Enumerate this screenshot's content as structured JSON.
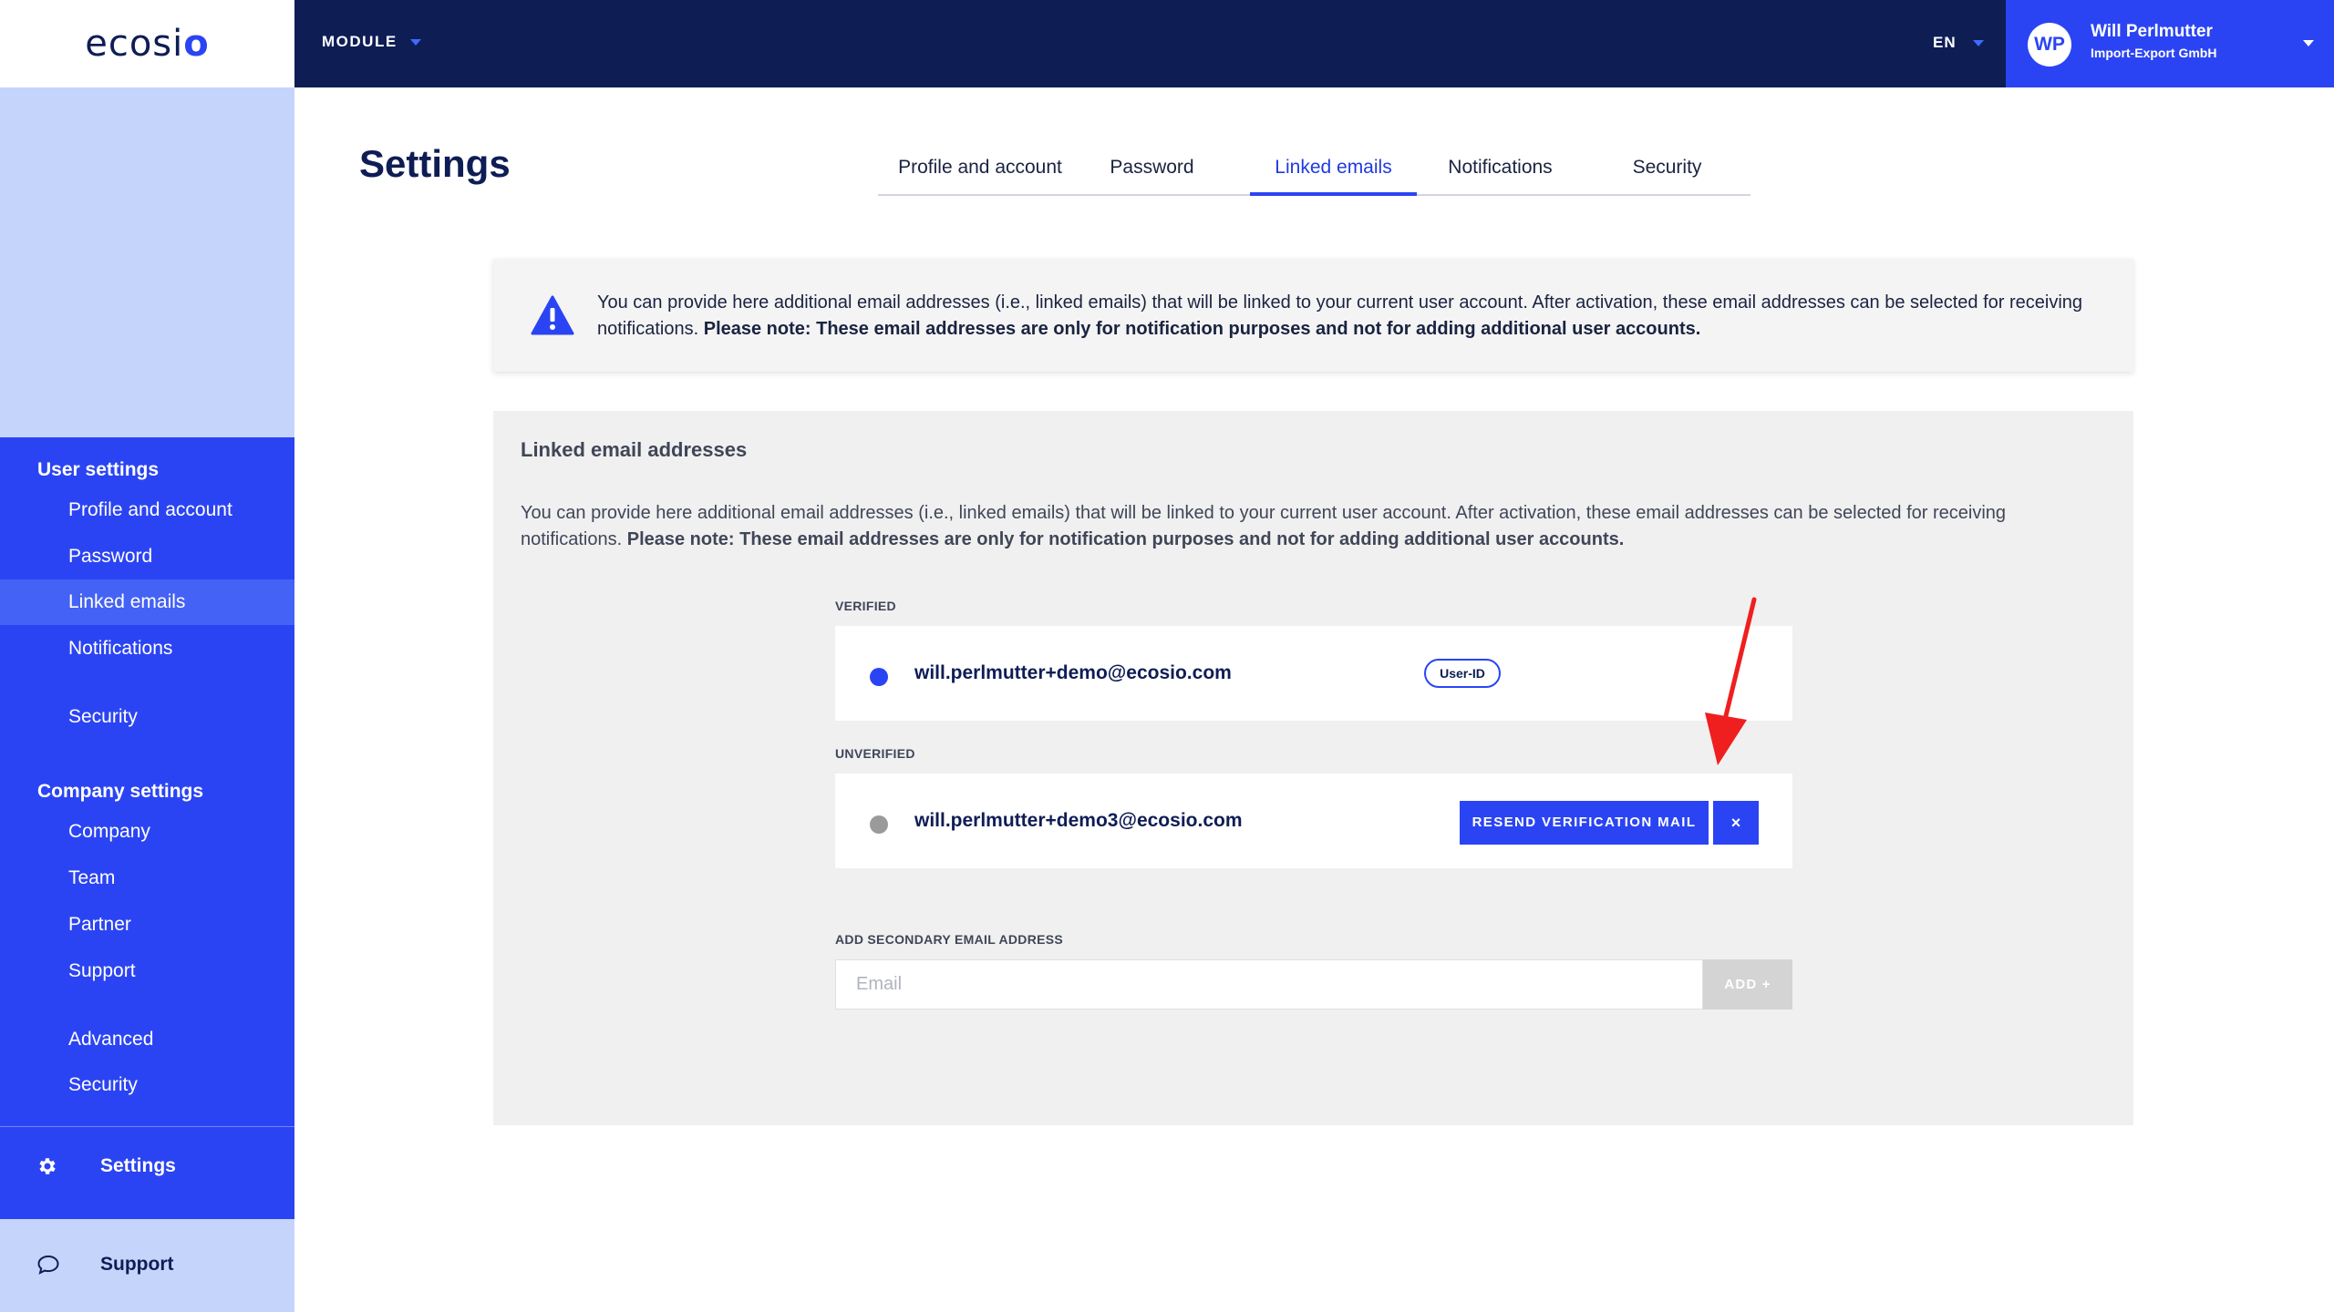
{
  "logo": "ecosio",
  "topbar": {
    "module_label": "MODULE",
    "language": "EN",
    "user": {
      "initials": "WP",
      "name": "Will Perlmutter",
      "company": "Import-Export GmbH"
    }
  },
  "sidebar": {
    "user_settings_title": "User settings",
    "user_items": [
      {
        "label": "Profile and account"
      },
      {
        "label": "Password"
      },
      {
        "label": "Linked emails",
        "active": true
      },
      {
        "label": "Notifications"
      },
      {
        "label": "Security"
      }
    ],
    "company_settings_title": "Company settings",
    "company_items": [
      {
        "label": "Company"
      },
      {
        "label": "Team"
      },
      {
        "label": "Partner"
      },
      {
        "label": "Support"
      },
      {
        "label": "Advanced"
      },
      {
        "label": "Security"
      }
    ],
    "settings_label": "Settings",
    "support_label": "Support"
  },
  "page": {
    "title": "Settings",
    "tabs": [
      {
        "label": "Profile and account"
      },
      {
        "label": "Password"
      },
      {
        "label": "Linked emails",
        "active": true
      },
      {
        "label": "Notifications"
      },
      {
        "label": "Security"
      }
    ]
  },
  "info": {
    "text": "You can provide here additional email addresses (i.e., linked emails) that will be linked to your current user account. After activation, these email addresses can be selected for receiving notifications. ",
    "note": "Please note: These email addresses are only for notification purposes and not for adding additional user accounts."
  },
  "panel": {
    "title": "Linked email addresses",
    "text": "You can provide here additional email addresses (i.e., linked emails) that will be linked to your current user account. After activation, these email addresses can be selected for receiving notifications. ",
    "note": "Please note: These email addresses are only for notification purposes and not for adding additional user accounts.",
    "verified_label": "VERIFIED",
    "verified_email": "will.perlmutter+demo@ecosio.com",
    "userid_badge": "User-ID",
    "unverified_label": "UNVERIFIED",
    "unverified_email": "will.perlmutter+demo3@ecosio.com",
    "resend_label": "RESEND VERIFICATION MAIL",
    "remove_label": "×",
    "add_label": "ADD SECONDARY EMAIL ADDRESS",
    "email_placeholder": "Email",
    "add_button": "ADD +"
  },
  "colors": {
    "brand_blue": "#2b44f3",
    "navy": "#0f1d55",
    "sidebar_light": "#c5d4fb",
    "verified_dot": "#2b44f3",
    "unverified_dot": "#9a9a9a",
    "annotation_arrow": "#f01f1f"
  }
}
